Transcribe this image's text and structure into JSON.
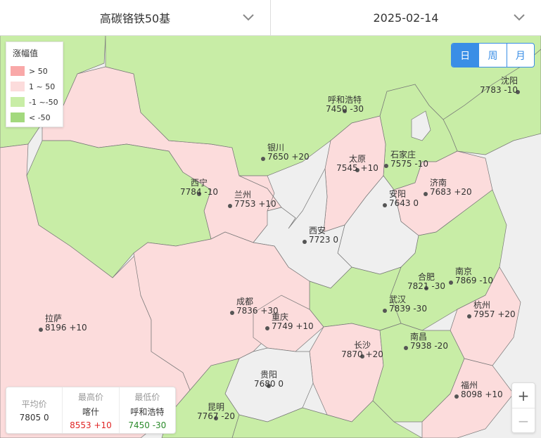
{
  "header": {
    "product": "高碳铬铁50基",
    "date": "2025-02-14"
  },
  "legend": {
    "title": "涨幅值",
    "items": [
      {
        "label": "> 50",
        "color": "#f9a8a8"
      },
      {
        "label": "1 ~ 50",
        "color": "#fcdcdc"
      },
      {
        "label": "-1 ~-50",
        "color": "#c8eda6"
      },
      {
        "label": "< -50",
        "color": "#a3d97e"
      }
    ]
  },
  "period": {
    "day": "日",
    "week": "周",
    "month": "月",
    "active": "day"
  },
  "cities": [
    {
      "name": "沈阳",
      "value": "7783 -10"
    },
    {
      "name": "呼和浩特",
      "value": "7450 -30"
    },
    {
      "name": "银川",
      "value": "7650 +20"
    },
    {
      "name": "太原",
      "value": "7545 +10"
    },
    {
      "name": "石家庄",
      "value": "7575 -10"
    },
    {
      "name": "西宁",
      "value": "7784 -10"
    },
    {
      "name": "兰州",
      "value": "7753 +10"
    },
    {
      "name": "安阳",
      "value": "7643 0"
    },
    {
      "name": "济南",
      "value": "7683 +20"
    },
    {
      "name": "西安",
      "value": "7723 0"
    },
    {
      "name": "合肥",
      "value": "7821 -30"
    },
    {
      "name": "南京",
      "value": "7869 -10"
    },
    {
      "name": "成都",
      "value": "7836 +30"
    },
    {
      "name": "武汉",
      "value": "7839 -30"
    },
    {
      "name": "杭州",
      "value": "7957 +20"
    },
    {
      "name": "重庆",
      "value": "7749 +10"
    },
    {
      "name": "拉萨",
      "value": "8196 +10"
    },
    {
      "name": "长沙",
      "value": "7870 +20"
    },
    {
      "name": "南昌",
      "value": "7938 -20"
    },
    {
      "name": "贵阳",
      "value": "7680 0"
    },
    {
      "name": "福州",
      "value": "8098 +10"
    },
    {
      "name": "昆明",
      "value": "7767 -20"
    }
  ],
  "stats": {
    "avg_label": "平均价",
    "avg_value": "7805 0",
    "max_label": "最高价",
    "max_city": "喀什",
    "max_value": "8553 +10",
    "min_label": "最低价",
    "min_city": "呼和浩特",
    "min_value": "7450 -30"
  },
  "zoom": {
    "in": "+",
    "out": "−"
  },
  "colors": {
    "up_small": "#fcdcdc",
    "down_small": "#c8eda6",
    "neutral": "#efefef",
    "accent": "#3a8ee6"
  }
}
